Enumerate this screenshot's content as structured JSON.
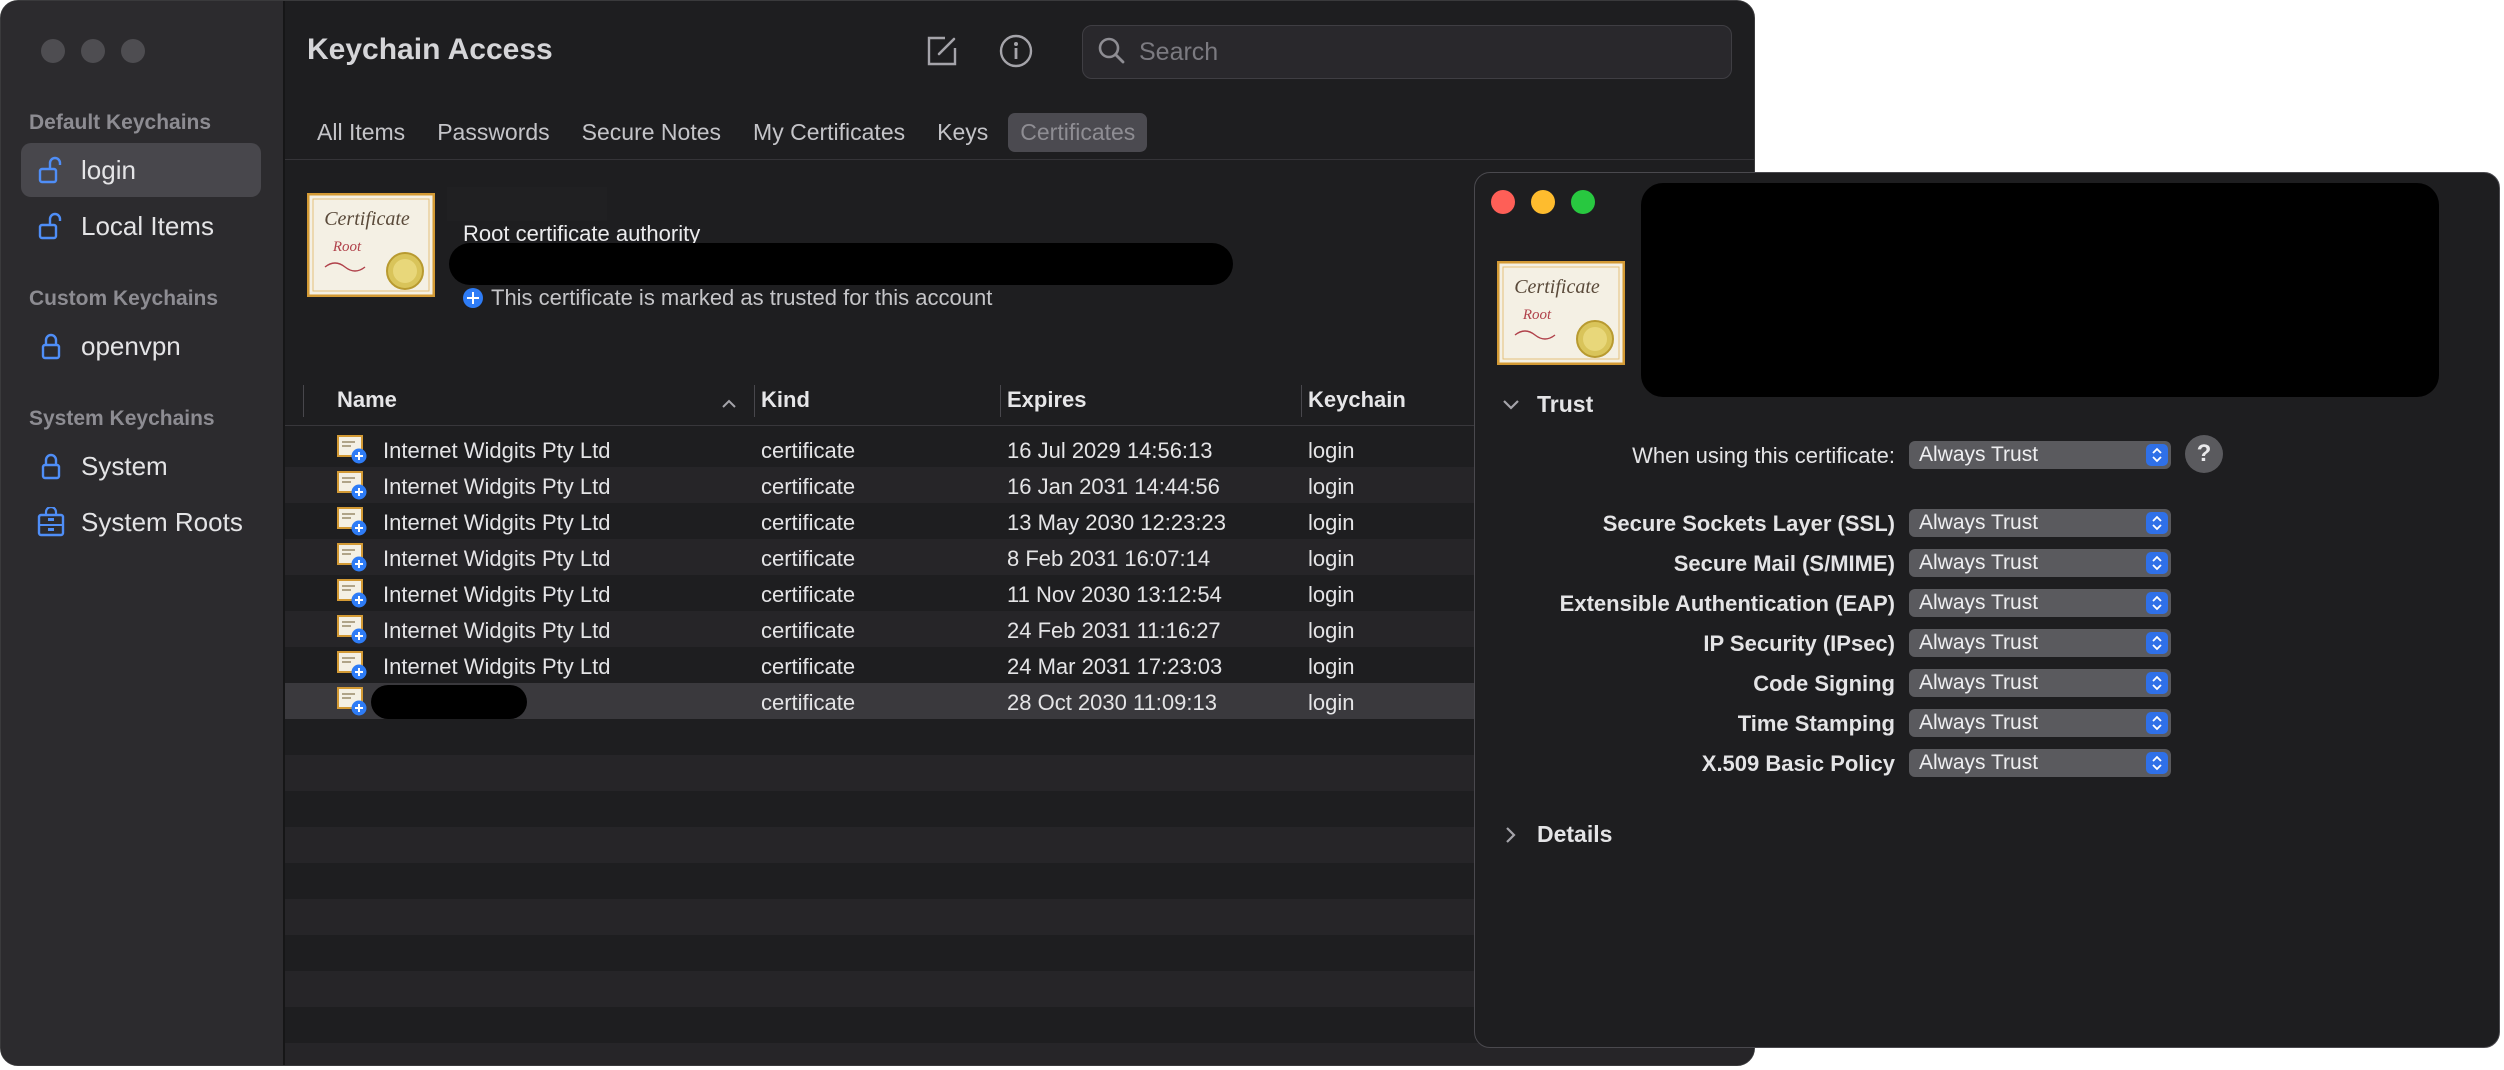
{
  "app": {
    "title": "Keychain Access"
  },
  "toolbar": {
    "search_placeholder": "Search",
    "compose_icon": "compose-icon",
    "info_icon": "info-icon"
  },
  "sidebar": {
    "default_header": "Default Keychains",
    "default_items": [
      {
        "label": "login",
        "icon": "unlocked-padlock-icon",
        "selected": true
      },
      {
        "label": "Local Items",
        "icon": "unlocked-padlock-icon"
      }
    ],
    "custom_header": "Custom Keychains",
    "custom_items": [
      {
        "label": "openvpn",
        "icon": "locked-padlock-icon"
      }
    ],
    "system_header": "System Keychains",
    "system_items": [
      {
        "label": "System",
        "icon": "locked-padlock-icon"
      },
      {
        "label": "System Roots",
        "icon": "cabinet-icon"
      }
    ]
  },
  "tabs": [
    {
      "label": "All Items"
    },
    {
      "label": "Passwords"
    },
    {
      "label": "Secure Notes"
    },
    {
      "label": "My Certificates"
    },
    {
      "label": "Keys"
    },
    {
      "label": "Certificates",
      "active": true
    }
  ],
  "selected_cert": {
    "icon_title": "Certificate",
    "icon_subtitle": "Root",
    "title": "Root certificate authority",
    "status": "This certificate is marked as trusted for this account"
  },
  "table": {
    "columns": {
      "name": "Name",
      "kind": "Kind",
      "expires": "Expires",
      "keychain": "Keychain"
    },
    "rows": [
      {
        "name": "Internet Widgits Pty Ltd",
        "kind": "certificate",
        "expires": "16 Jul 2029 14:56:13",
        "keychain": "login"
      },
      {
        "name": "Internet Widgits Pty Ltd",
        "kind": "certificate",
        "expires": "16 Jan 2031 14:44:56",
        "keychain": "login"
      },
      {
        "name": "Internet Widgits Pty Ltd",
        "kind": "certificate",
        "expires": "13 May 2030 12:23:23",
        "keychain": "login"
      },
      {
        "name": "Internet Widgits Pty Ltd",
        "kind": "certificate",
        "expires": "8 Feb 2031 16:07:14",
        "keychain": "login"
      },
      {
        "name": "Internet Widgits Pty Ltd",
        "kind": "certificate",
        "expires": "11 Nov 2030 13:12:54",
        "keychain": "login"
      },
      {
        "name": "Internet Widgits Pty Ltd",
        "kind": "certificate",
        "expires": "24 Feb 2031 11:16:27",
        "keychain": "login"
      },
      {
        "name": "Internet Widgits Pty Ltd",
        "kind": "certificate",
        "expires": "24 Mar 2031 17:23:03",
        "keychain": "login"
      },
      {
        "name": "",
        "kind": "certificate",
        "expires": "28 Oct 2030 11:09:13",
        "keychain": "login",
        "selected": true
      }
    ]
  },
  "detail": {
    "trust_section": "Trust",
    "details_section": "Details",
    "when_using_label": "When using this certificate:",
    "when_using_value": "Always Trust",
    "help_label": "?",
    "policies": [
      {
        "label": "Secure Sockets Layer (SSL)",
        "value": "Always Trust"
      },
      {
        "label": "Secure Mail (S/MIME)",
        "value": "Always Trust"
      },
      {
        "label": "Extensible Authentication (EAP)",
        "value": "Always Trust"
      },
      {
        "label": "IP Security (IPsec)",
        "value": "Always Trust"
      },
      {
        "label": "Code Signing",
        "value": "Always Trust"
      },
      {
        "label": "Time Stamping",
        "value": "Always Trust"
      },
      {
        "label": "X.509 Basic Policy",
        "value": "Always Trust"
      }
    ]
  },
  "colors": {
    "accent": "#2f70e8",
    "close": "#fe5f57",
    "minimize": "#febc2e",
    "zoom": "#28c840"
  }
}
